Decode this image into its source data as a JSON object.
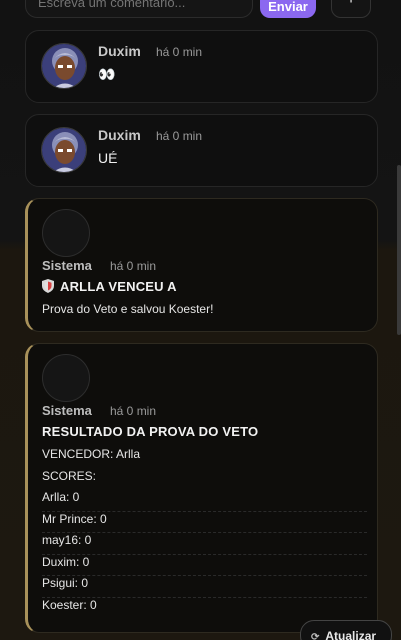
{
  "composer": {
    "placeholder": "Escreva um comentário...",
    "send_label": "Enviar",
    "plus_label": "+"
  },
  "comments": [
    {
      "user": "Duxim",
      "time": "há 0 min",
      "text": "👀"
    },
    {
      "user": "Duxim",
      "time": "há 0 min",
      "text": "UÉ"
    }
  ],
  "system_posts": [
    {
      "user": "Sistema",
      "time": "há 0 min",
      "title": "ARLLA VENCEU A",
      "body": "Prova do Veto e salvou Koester!"
    },
    {
      "user": "Sistema",
      "time": "há 0 min",
      "title": "RESULTADO DA PROVA DO VETO",
      "lines": [
        "VENCEDOR: Arlla",
        "SCORES:",
        "Arlla: 0",
        "Mr Prince: 0",
        "may16: 0",
        "Duxim: 0",
        "Psigui: 0",
        "Koester: 0"
      ]
    }
  ],
  "refresh_label": "Atualizar",
  "colors": {
    "accent": "#8b68f0",
    "system_border": "#a8915a"
  }
}
